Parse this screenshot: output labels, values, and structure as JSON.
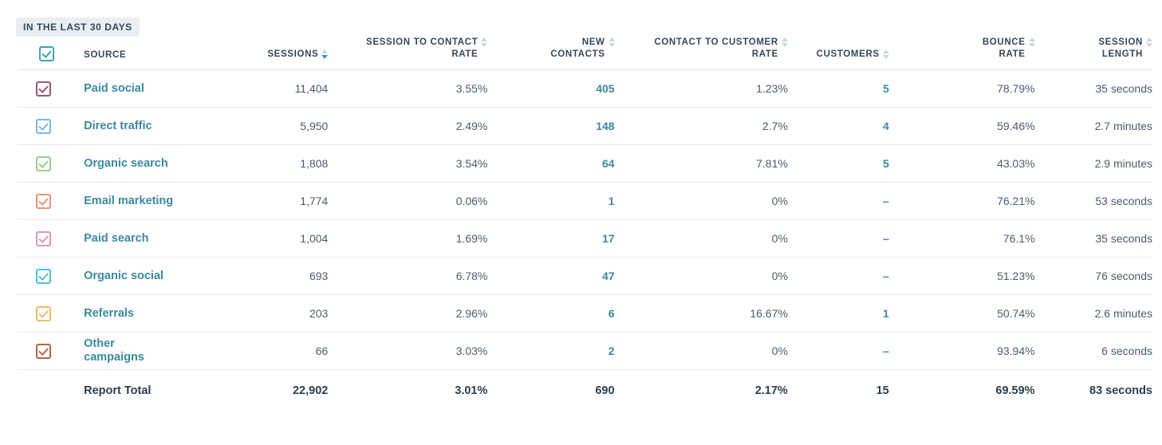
{
  "badge": {
    "label": "IN THE LAST 30 DAYS"
  },
  "colors": {
    "link": "#3b8aa0",
    "text": "#33475b",
    "header_checkbox": "#45a1b5",
    "sort_active": "#2e9bd6",
    "sort_inactive": "#cbd6e2",
    "badge_bg": "#eaeef2",
    "row_border": "#e5e8ed"
  },
  "table": {
    "header_checkbox": {
      "name": "select-all",
      "checked": true,
      "color": "#45a1b5"
    },
    "columns": [
      {
        "key": "source",
        "label": "SOURCE",
        "align": "left",
        "sortable": false
      },
      {
        "key": "sessions",
        "label": "SESSIONS",
        "align": "right",
        "sortable": true,
        "sort": "desc"
      },
      {
        "key": "session_to_contact_rate",
        "label": "SESSION TO CONTACT\nRATE",
        "align": "right",
        "sortable": true,
        "sort": "none"
      },
      {
        "key": "new_contacts",
        "label": "NEW\nCONTACTS",
        "align": "right",
        "sortable": true,
        "sort": "none"
      },
      {
        "key": "contact_to_customer_rate",
        "label": "CONTACT TO CUSTOMER\nRATE",
        "align": "right",
        "sortable": true,
        "sort": "none"
      },
      {
        "key": "customers",
        "label": "CUSTOMERS",
        "align": "right",
        "sortable": true,
        "sort": "none"
      },
      {
        "key": "bounce_rate",
        "label": "BOUNCE\nRATE",
        "align": "right",
        "sortable": true,
        "sort": "none"
      },
      {
        "key": "session_length",
        "label": "SESSION\nLENGTH",
        "align": "right",
        "sortable": true,
        "sort": "none"
      }
    ],
    "rows": [
      {
        "checkbox_color": "#9e5573",
        "source": "Paid social",
        "sessions": "11,404",
        "session_to_contact_rate": "3.55%",
        "new_contacts": "405",
        "contact_to_customer_rate": "1.23%",
        "customers": "5",
        "bounce_rate": "78.79%",
        "session_length": "35 seconds"
      },
      {
        "checkbox_color": "#7fb5e8",
        "source": "Direct traffic",
        "sessions": "5,950",
        "session_to_contact_rate": "2.49%",
        "new_contacts": "148",
        "contact_to_customer_rate": "2.7%",
        "customers": "4",
        "bounce_rate": "59.46%",
        "session_length": "2.7 minutes"
      },
      {
        "checkbox_color": "#97cf89",
        "source": "Organic search",
        "sessions": "1,808",
        "session_to_contact_rate": "3.54%",
        "new_contacts": "64",
        "contact_to_customer_rate": "7.81%",
        "customers": "5",
        "bounce_rate": "43.03%",
        "session_length": "2.9 minutes"
      },
      {
        "checkbox_color": "#ef9377",
        "source": "Email marketing",
        "sessions": "1,774",
        "session_to_contact_rate": "0.06%",
        "new_contacts": "1",
        "contact_to_customer_rate": "0%",
        "customers": "–",
        "bounce_rate": "76.21%",
        "session_length": "53 seconds"
      },
      {
        "checkbox_color": "#e095b6",
        "source": "Paid search",
        "sessions": "1,004",
        "session_to_contact_rate": "1.69%",
        "new_contacts": "17",
        "contact_to_customer_rate": "0%",
        "customers": "–",
        "bounce_rate": "76.1%",
        "session_length": "35 seconds"
      },
      {
        "checkbox_color": "#4ec3d4",
        "source": "Organic social",
        "sessions": "693",
        "session_to_contact_rate": "6.78%",
        "new_contacts": "47",
        "contact_to_customer_rate": "0%",
        "customers": "–",
        "bounce_rate": "51.23%",
        "session_length": "76 seconds"
      },
      {
        "checkbox_color": "#f0bb6d",
        "source": "Referrals",
        "sessions": "203",
        "session_to_contact_rate": "2.96%",
        "new_contacts": "6",
        "contact_to_customer_rate": "16.67%",
        "customers": "1",
        "bounce_rate": "50.74%",
        "session_length": "2.6 minutes"
      },
      {
        "checkbox_color": "#b4653f",
        "source": "Other campaigns",
        "sessions": "66",
        "session_to_contact_rate": "3.03%",
        "new_contacts": "2",
        "contact_to_customer_rate": "0%",
        "customers": "–",
        "bounce_rate": "93.94%",
        "session_length": "6 seconds"
      }
    ],
    "total": {
      "source": "Report Total",
      "sessions": "22,902",
      "session_to_contact_rate": "3.01%",
      "new_contacts": "690",
      "contact_to_customer_rate": "2.17%",
      "customers": "15",
      "bounce_rate": "69.59%",
      "session_length": "83 seconds"
    }
  }
}
